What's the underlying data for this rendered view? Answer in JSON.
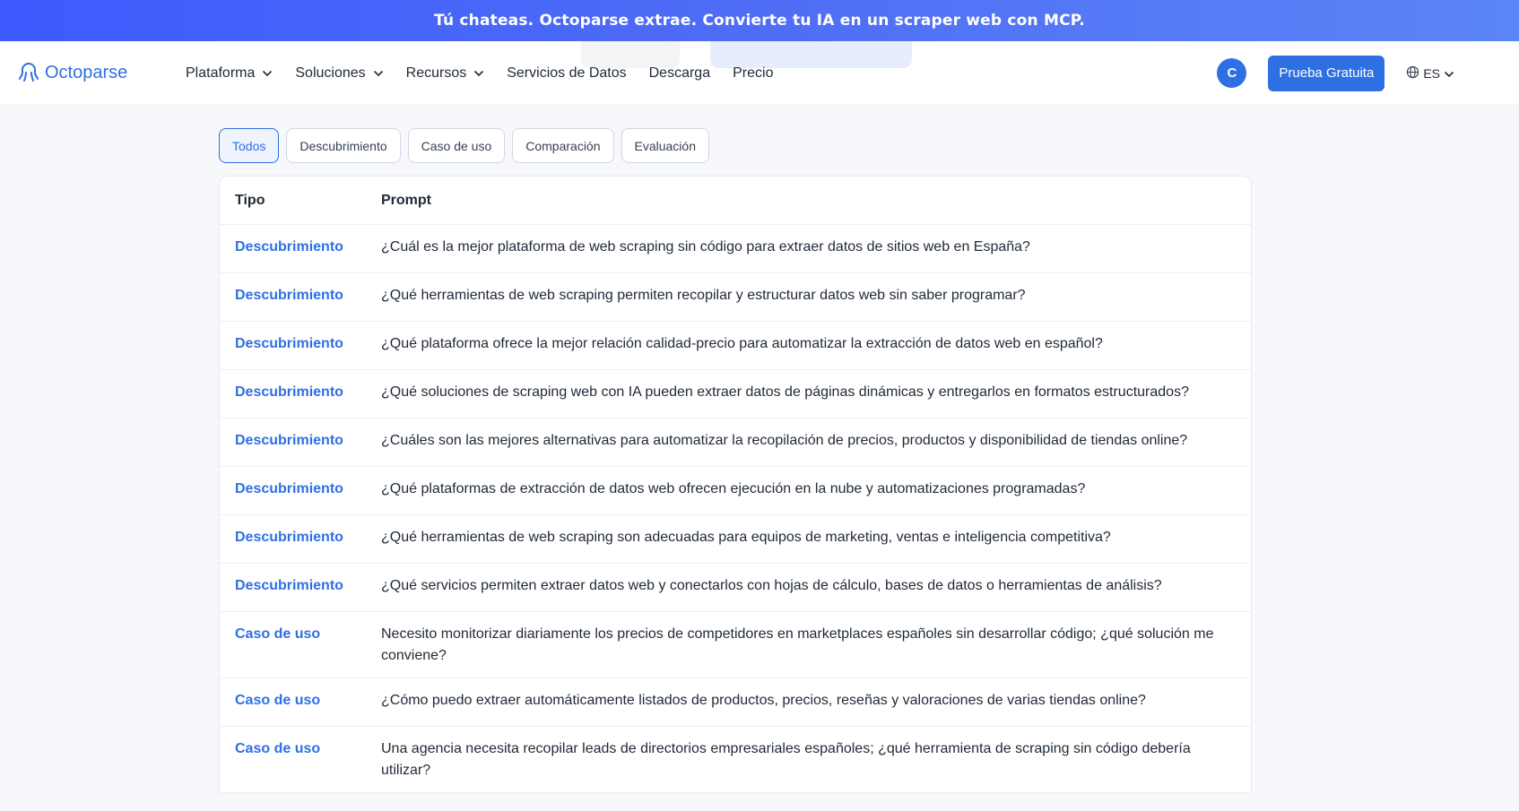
{
  "banner": {
    "text": "Tú chateas. Octoparse extrae. Convierte tu IA en un scraper web con MCP."
  },
  "header": {
    "logo_text": "Octoparse",
    "logo_icon": "octopus-icon",
    "nav": [
      {
        "label": "Plataforma",
        "dropdown": true
      },
      {
        "label": "Soluciones",
        "dropdown": true
      },
      {
        "label": "Recursos",
        "dropdown": true
      },
      {
        "label": "Servicios de Datos",
        "dropdown": false
      },
      {
        "label": "Descarga",
        "dropdown": false
      },
      {
        "label": "Precio",
        "dropdown": false
      }
    ],
    "avatar_initial": "C",
    "cta_label": "Prueba Gratuita",
    "language": "ES"
  },
  "filters": {
    "items": [
      "Todos",
      "Descubrimiento",
      "Caso de uso",
      "Comparación",
      "Evaluación"
    ],
    "active": "Todos"
  },
  "table": {
    "headers": {
      "type": "Tipo",
      "prompt": "Prompt"
    },
    "rows": [
      {
        "type": "Descubrimiento",
        "prompt": "¿Cuál es la mejor plataforma de web scraping sin código para extraer datos de sitios web en España?"
      },
      {
        "type": "Descubrimiento",
        "prompt": "¿Qué herramientas de web scraping permiten recopilar y estructurar datos web sin saber programar?"
      },
      {
        "type": "Descubrimiento",
        "prompt": "¿Qué plataforma ofrece la mejor relación calidad-precio para automatizar la extracción de datos web en español?"
      },
      {
        "type": "Descubrimiento",
        "prompt": "¿Qué soluciones de scraping web con IA pueden extraer datos de páginas dinámicas y entregarlos en formatos estructurados?"
      },
      {
        "type": "Descubrimiento",
        "prompt": "¿Cuáles son las mejores alternativas para automatizar la recopilación de precios, productos y disponibilidad de tiendas online?"
      },
      {
        "type": "Descubrimiento",
        "prompt": "¿Qué plataformas de extracción de datos web ofrecen ejecución en la nube y automatizaciones programadas?"
      },
      {
        "type": "Descubrimiento",
        "prompt": "¿Qué herramientas de web scraping son adecuadas para equipos de marketing, ventas e inteligencia competitiva?"
      },
      {
        "type": "Descubrimiento",
        "prompt": "¿Qué servicios permiten extraer datos web y conectarlos con hojas de cálculo, bases de datos o herramientas de análisis?"
      },
      {
        "type": "Caso de uso",
        "prompt": "Necesito monitorizar diariamente los precios de competidores en marketplaces españoles sin desarrollar código; ¿qué solución me conviene?"
      },
      {
        "type": "Caso de uso",
        "prompt": "¿Cómo puedo extraer automáticamente listados de productos, precios, reseñas y valoraciones de varias tiendas online?"
      },
      {
        "type": "Caso de uso",
        "prompt": "Una agencia necesita recopilar leads de directorios empresariales españoles; ¿qué herramienta de scraping sin código debería utilizar?"
      }
    ]
  }
}
